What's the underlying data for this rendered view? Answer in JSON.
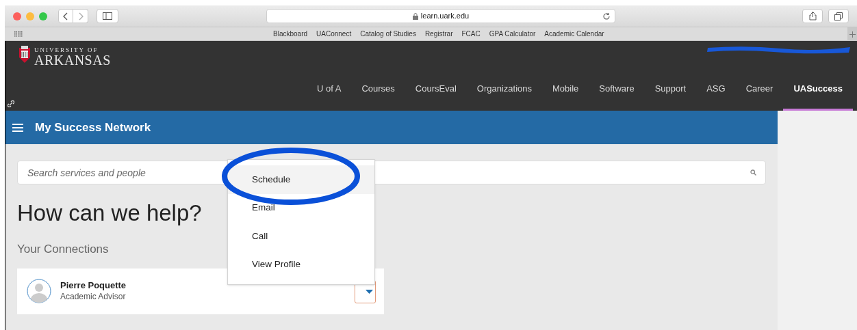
{
  "browser": {
    "address": "learn.uark.edu",
    "bookmarks": [
      "Blackboard",
      "UAConnect",
      "Catalog of Studies",
      "Registrar",
      "FCAC",
      "GPA Calculator",
      "Academic Calendar"
    ]
  },
  "site_header": {
    "logo_line_1": "UNIVERSITY OF",
    "logo_line_2": "ARKANSAS",
    "nav": [
      {
        "label": "U of A",
        "selected": false
      },
      {
        "label": "Courses",
        "selected": false
      },
      {
        "label": "CoursEval",
        "selected": false
      },
      {
        "label": "Organizations",
        "selected": false
      },
      {
        "label": "Mobile",
        "selected": false
      },
      {
        "label": "Software",
        "selected": false
      },
      {
        "label": "Support",
        "selected": false
      },
      {
        "label": "ASG",
        "selected": false
      },
      {
        "label": "Career",
        "selected": false
      },
      {
        "label": "UASuccess",
        "selected": true
      }
    ]
  },
  "app_bar": {
    "title": "My Success Network"
  },
  "search": {
    "placeholder": "Search services and people"
  },
  "heading": "How can we help?",
  "connections_label": "Your Connections",
  "connection": {
    "name": "Pierre Poquette",
    "role": "Academic Advisor"
  },
  "menu": [
    {
      "label": "Schedule",
      "selected": true
    },
    {
      "label": "Email",
      "selected": false
    },
    {
      "label": "Call",
      "selected": false
    },
    {
      "label": "View Profile",
      "selected": false
    }
  ]
}
